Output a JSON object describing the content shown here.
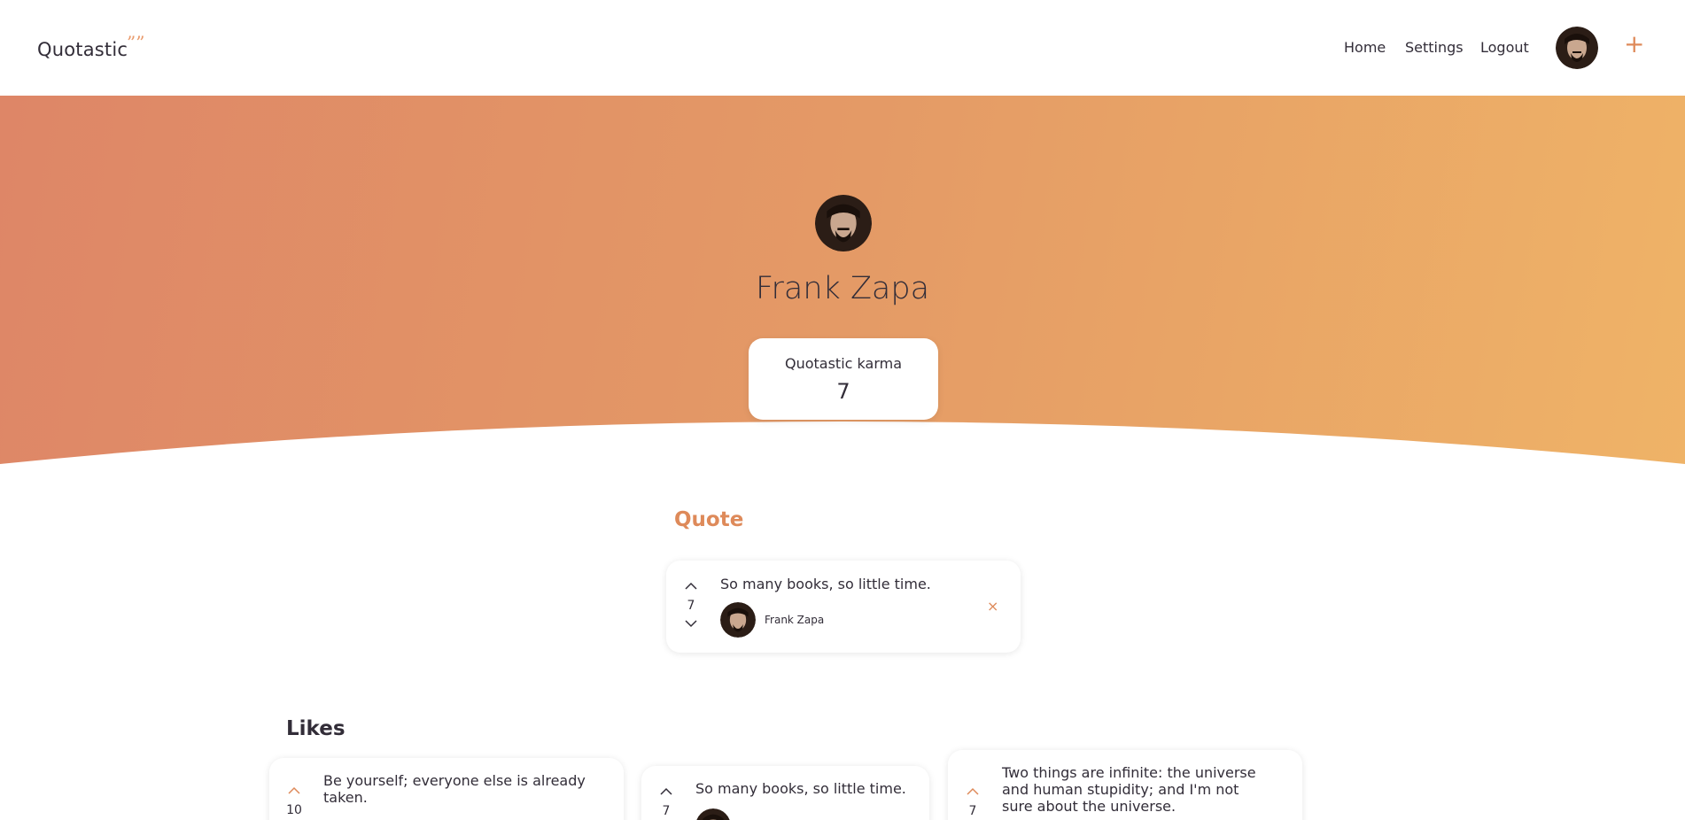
{
  "brand": {
    "name": "Quotastic",
    "mark": "””"
  },
  "nav": {
    "home": "Home",
    "settings": "Settings",
    "logout": "Logout",
    "add": "+"
  },
  "profile": {
    "name": "Frank Zapa",
    "karma_label": "Quotastic karma",
    "karma_value": "7"
  },
  "quote_section": {
    "title": "Quote",
    "quote": {
      "text": "So many books, so little time.",
      "votes": "7",
      "author": "Frank Zapa",
      "delete": "×"
    }
  },
  "likes_section": {
    "title": "Likes",
    "items": [
      {
        "text": "Be yourself; everyone else is already taken.",
        "votes": "10"
      },
      {
        "text": "So many books, so little time.",
        "votes": "7"
      },
      {
        "text": "Two things are infinite: the universe and human stupidity; and I'm not sure about the universe.",
        "votes": "7"
      }
    ]
  },
  "colors": {
    "accent": "#de8a5a",
    "text": "#322d38",
    "gradient_start": "#de8667",
    "gradient_end": "#efb367"
  },
  "icons": {
    "upvote": "chevron-up-icon",
    "downvote": "chevron-down-icon",
    "avatar": "user-avatar"
  }
}
